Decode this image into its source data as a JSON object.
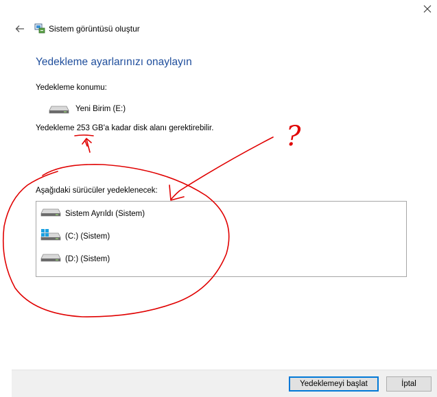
{
  "window": {
    "title": "Sistem görüntüsü oluştur",
    "back_icon": "back-arrow-icon",
    "close_icon": "close-icon"
  },
  "page": {
    "heading": "Yedekleme ayarlarınızı onaylayın",
    "location_label": "Yedekleme konumu:",
    "destination": {
      "name": "Yeni Birim (E:)",
      "icon": "drive-icon"
    },
    "space_prefix": "Yedekleme ",
    "space_amount": "253 GB",
    "space_suffix": "'a kadar disk alanı gerektirebilir.",
    "drives_label": "Aşağıdaki sürücüler yedeklenecek:",
    "drives": [
      {
        "label": "Sistem Ayrıldı (Sistem)",
        "icon": "drive-icon"
      },
      {
        "label": "(C:) (Sistem)",
        "icon": "windows-drive-icon"
      },
      {
        "label": "(D:) (Sistem)",
        "icon": "drive-icon"
      }
    ]
  },
  "footer": {
    "start_label": "Yedeklemeyi başlat",
    "cancel_label": "İptal"
  },
  "annotations": {
    "question_mark": "?",
    "ink_color": "#e00000"
  },
  "colors": {
    "heading": "#1f4e9c",
    "button_focus": "#0078d7",
    "footer_bg": "#f0f0f0"
  }
}
